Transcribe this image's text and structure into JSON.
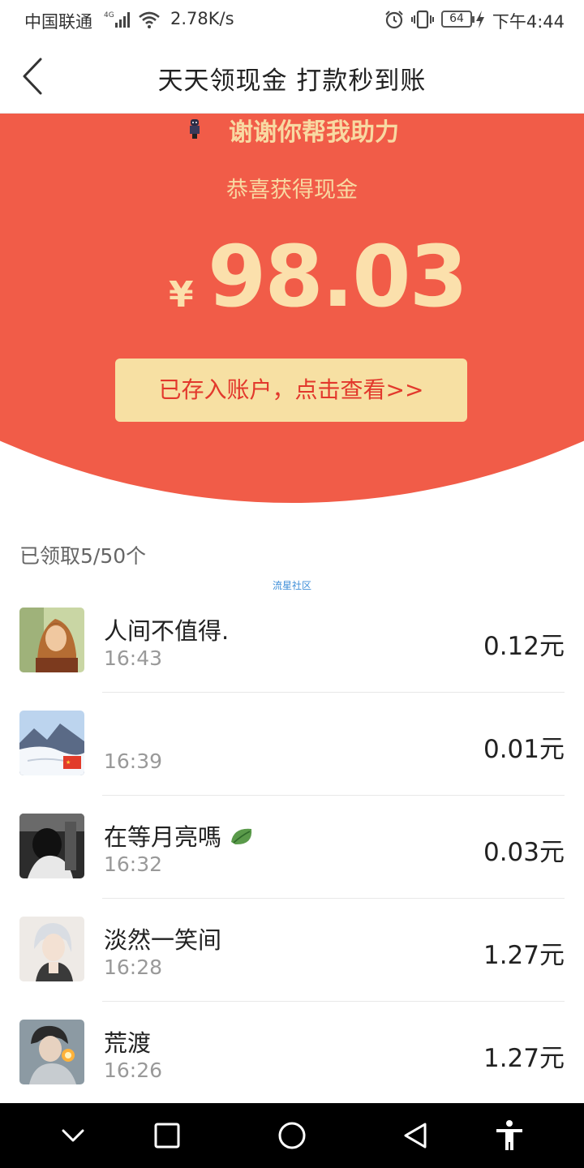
{
  "status_bar": {
    "carrier": "中国联通",
    "network_badge": "4G",
    "speed": "2.78K/s",
    "battery": "64",
    "clock": "下午4:44"
  },
  "header": {
    "title": "天天领现金 打款秒到账"
  },
  "hero": {
    "thanks": "谢谢你帮我助力",
    "subtitle": "恭喜获得现金",
    "currency": "¥",
    "amount": "98.03",
    "button_label": "已存入账户，点击查看>>"
  },
  "claimed": {
    "label": "已领取5/50个"
  },
  "watermark": "流星社区",
  "records": [
    {
      "name": "人间不值得.",
      "time": "16:43",
      "amount": "0.12元"
    },
    {
      "name": "",
      "time": "16:39",
      "amount": "0.01元"
    },
    {
      "name": "在等月亮嗎",
      "time": "16:32",
      "amount": "0.03元"
    },
    {
      "name": "淡然一笑间",
      "time": "16:28",
      "amount": "1.27元"
    },
    {
      "name": "荒渡",
      "time": "16:26",
      "amount": "1.27元"
    }
  ],
  "colors": {
    "hero_red": "#f15c48",
    "gold_text": "#fbe0ac",
    "button_bg": "#f7e0a3",
    "button_text": "#e2382c"
  }
}
